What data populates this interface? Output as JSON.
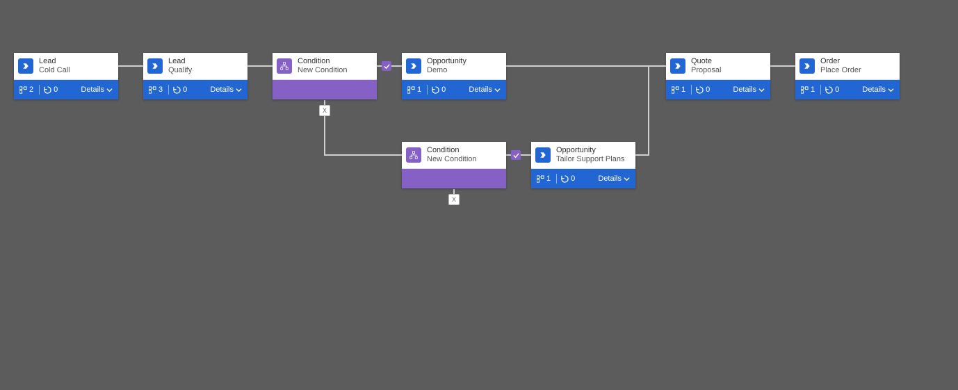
{
  "labels": {
    "details": "Details"
  },
  "nodes": {
    "n1": {
      "type": "stage",
      "title": "Lead",
      "subtitle": "Cold Call",
      "steps": "2",
      "loops": "0"
    },
    "n2": {
      "type": "stage",
      "title": "Lead",
      "subtitle": "Qualify",
      "steps": "3",
      "loops": "0"
    },
    "n3": {
      "type": "condition",
      "title": "Condition",
      "subtitle": "New Condition"
    },
    "n4": {
      "type": "stage",
      "title": "Opportunity",
      "subtitle": "Demo",
      "steps": "1",
      "loops": "0"
    },
    "n5": {
      "type": "stage",
      "title": "Quote",
      "subtitle": "Proposal",
      "steps": "1",
      "loops": "0"
    },
    "n6": {
      "type": "stage",
      "title": "Order",
      "subtitle": "Place Order",
      "steps": "1",
      "loops": "0"
    },
    "n7": {
      "type": "condition",
      "title": "Condition",
      "subtitle": "New Condition"
    },
    "n8": {
      "type": "stage",
      "title": "Opportunity",
      "subtitle": "Tailor Support Plans",
      "steps": "1",
      "loops": "0"
    }
  },
  "badges": {
    "x": "X"
  }
}
